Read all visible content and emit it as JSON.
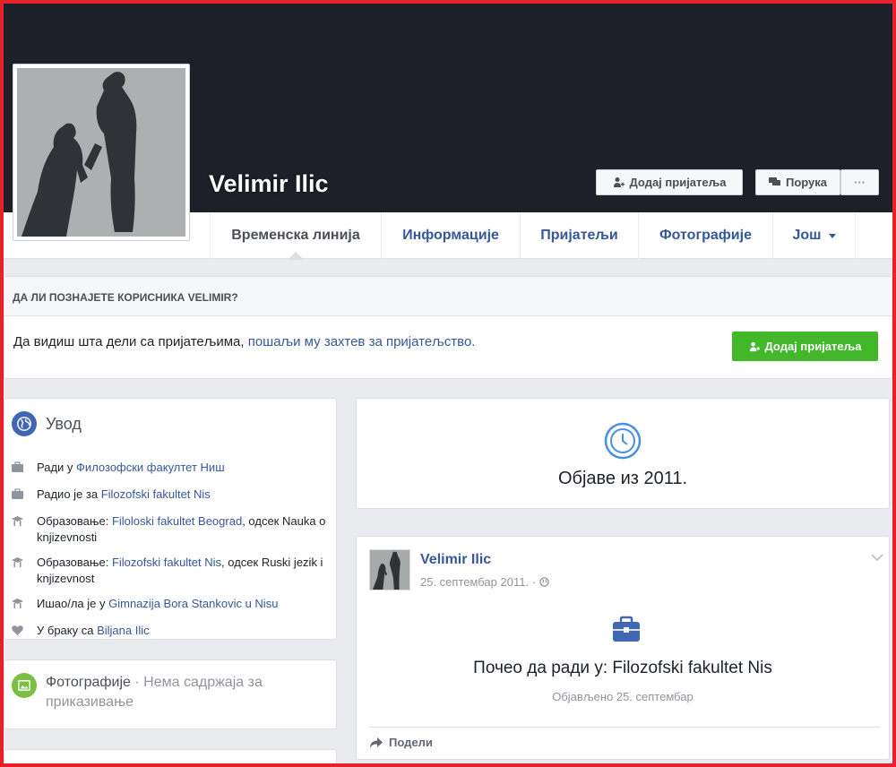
{
  "profile": {
    "name": "Velimir Ilic"
  },
  "cover_actions": {
    "add_friend": "Додај пријатеља",
    "message": "Порука",
    "more": "···"
  },
  "tabs": [
    {
      "label": "Временска линија",
      "active": true
    },
    {
      "label": "Информације"
    },
    {
      "label": "Пријатељи"
    },
    {
      "label": "Фотографије"
    },
    {
      "label": "Још"
    }
  ],
  "know": {
    "heading": "ДА ЛИ ПОЗНАЈЕТЕ КОРИСНИКА VELIMIR?",
    "text": "Да видиш шта дели са пријатељима, ",
    "link": "пошаљи му захтев за пријатељство.",
    "button": "Додај пријатеља"
  },
  "intro": {
    "title": "Увод",
    "items": [
      {
        "icon": "briefcase-icon",
        "prefix": "Ради у ",
        "link": "Филозофски факултет Ниш",
        "suffix": ""
      },
      {
        "icon": "briefcase-icon",
        "prefix": "Радио је за ",
        "link": "Filozofski fakultet Nis",
        "suffix": ""
      },
      {
        "icon": "graduation-cap-icon",
        "prefix": "Образовање: ",
        "link": "Filoloski fakultet Beograd",
        "suffix": ", одсек Nauka o knjizevnosti"
      },
      {
        "icon": "graduation-cap-icon",
        "prefix": "Образовање: ",
        "link": "Filozofski fakultet Nis",
        "suffix": ", одсек Ruski jezik i knjizevnost"
      },
      {
        "icon": "graduation-cap-icon",
        "prefix": "Ишао/ла је у ",
        "link": "Gimnazija Bora Stankovic u Nisu",
        "suffix": ""
      },
      {
        "icon": "heart-icon",
        "prefix": "У браку са ",
        "link": "Biljana Ilic",
        "suffix": ""
      }
    ]
  },
  "photos": {
    "title": "Фотографије",
    "empty": " · Нема садржаја за приказивање"
  },
  "posts_year": {
    "text": "Објаве из 2011."
  },
  "post": {
    "author": "Velimir Ilic",
    "date": "25. септембар 2011. ·",
    "headline": "Почео да ради у: Filozofski fakultet Nis",
    "published": "Објављено 25. септембар",
    "share": "Подели"
  },
  "colors": {
    "cover": "#1d2029",
    "link": "#365899",
    "green": "#42b72a",
    "frame": "#e8202b"
  }
}
